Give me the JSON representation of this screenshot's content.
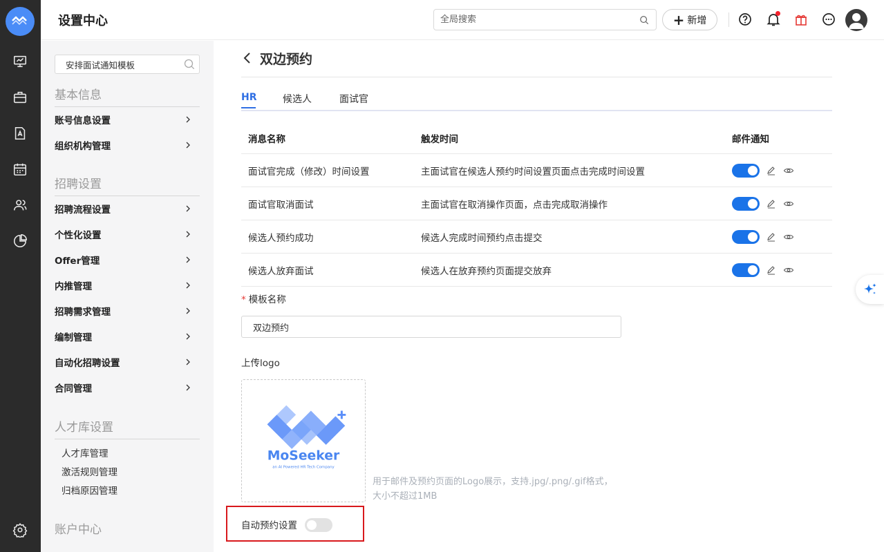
{
  "app": {
    "logo_text": "MoSeeker"
  },
  "header": {
    "title": "设置中心",
    "search_placeholder": "全局搜索",
    "add_label": "新增"
  },
  "sidebar": {
    "search_value": "安排面试通知模板",
    "sections": {
      "basic": "基本信息",
      "recruit": "招聘设置",
      "talent": "人才库设置",
      "account": "账户中心"
    },
    "basic_items": [
      "账号信息设置",
      "组织机构管理"
    ],
    "recruit_items": [
      "招聘流程设置",
      "个性化设置",
      "Offer管理",
      "内推管理",
      "招聘需求管理",
      "编制管理",
      "自动化招聘设置",
      "合同管理"
    ],
    "talent_items": [
      "人才库管理",
      "激活规则管理",
      "归档原因管理"
    ]
  },
  "page": {
    "title": "双边预约",
    "tabs": [
      "HR",
      "候选人",
      "面试官"
    ],
    "active_tab": "HR",
    "columns": [
      "消息名称",
      "触发时间",
      "邮件通知"
    ],
    "rows": [
      {
        "name": "面试官完成（修改）时间设置",
        "trigger": "主面试官在候选人预约时间设置页面点击完成时间设置",
        "email_on": true
      },
      {
        "name": "面试官取消面试",
        "trigger": "主面试官在取消操作页面，点击完成取消操作",
        "email_on": true
      },
      {
        "name": "候选人预约成功",
        "trigger": "候选人完成时间预约点击提交",
        "email_on": true
      },
      {
        "name": "候选人放弃面试",
        "trigger": "候选人在放弃预约页面提交放弃",
        "email_on": true
      }
    ],
    "template_name_label": "模板名称",
    "required_mark": "*",
    "template_name_value": "双边预约",
    "upload_logo_label": "上传logo",
    "logo_brand": "MoSeeker",
    "logo_tagline": "an AI Powered HR Tech Company",
    "upload_hint": "用于邮件及预约页面的Logo展示，支持.jpg/.png/.gif格式，大小不超过1MB",
    "auto_booking_label": "自动预约设置",
    "auto_booking_on": false
  },
  "colors": {
    "accent": "#2f6fe4",
    "switch_on": "#1a73e8",
    "highlight_border": "#d8181c",
    "rail_bg": "#2b2b2b"
  }
}
